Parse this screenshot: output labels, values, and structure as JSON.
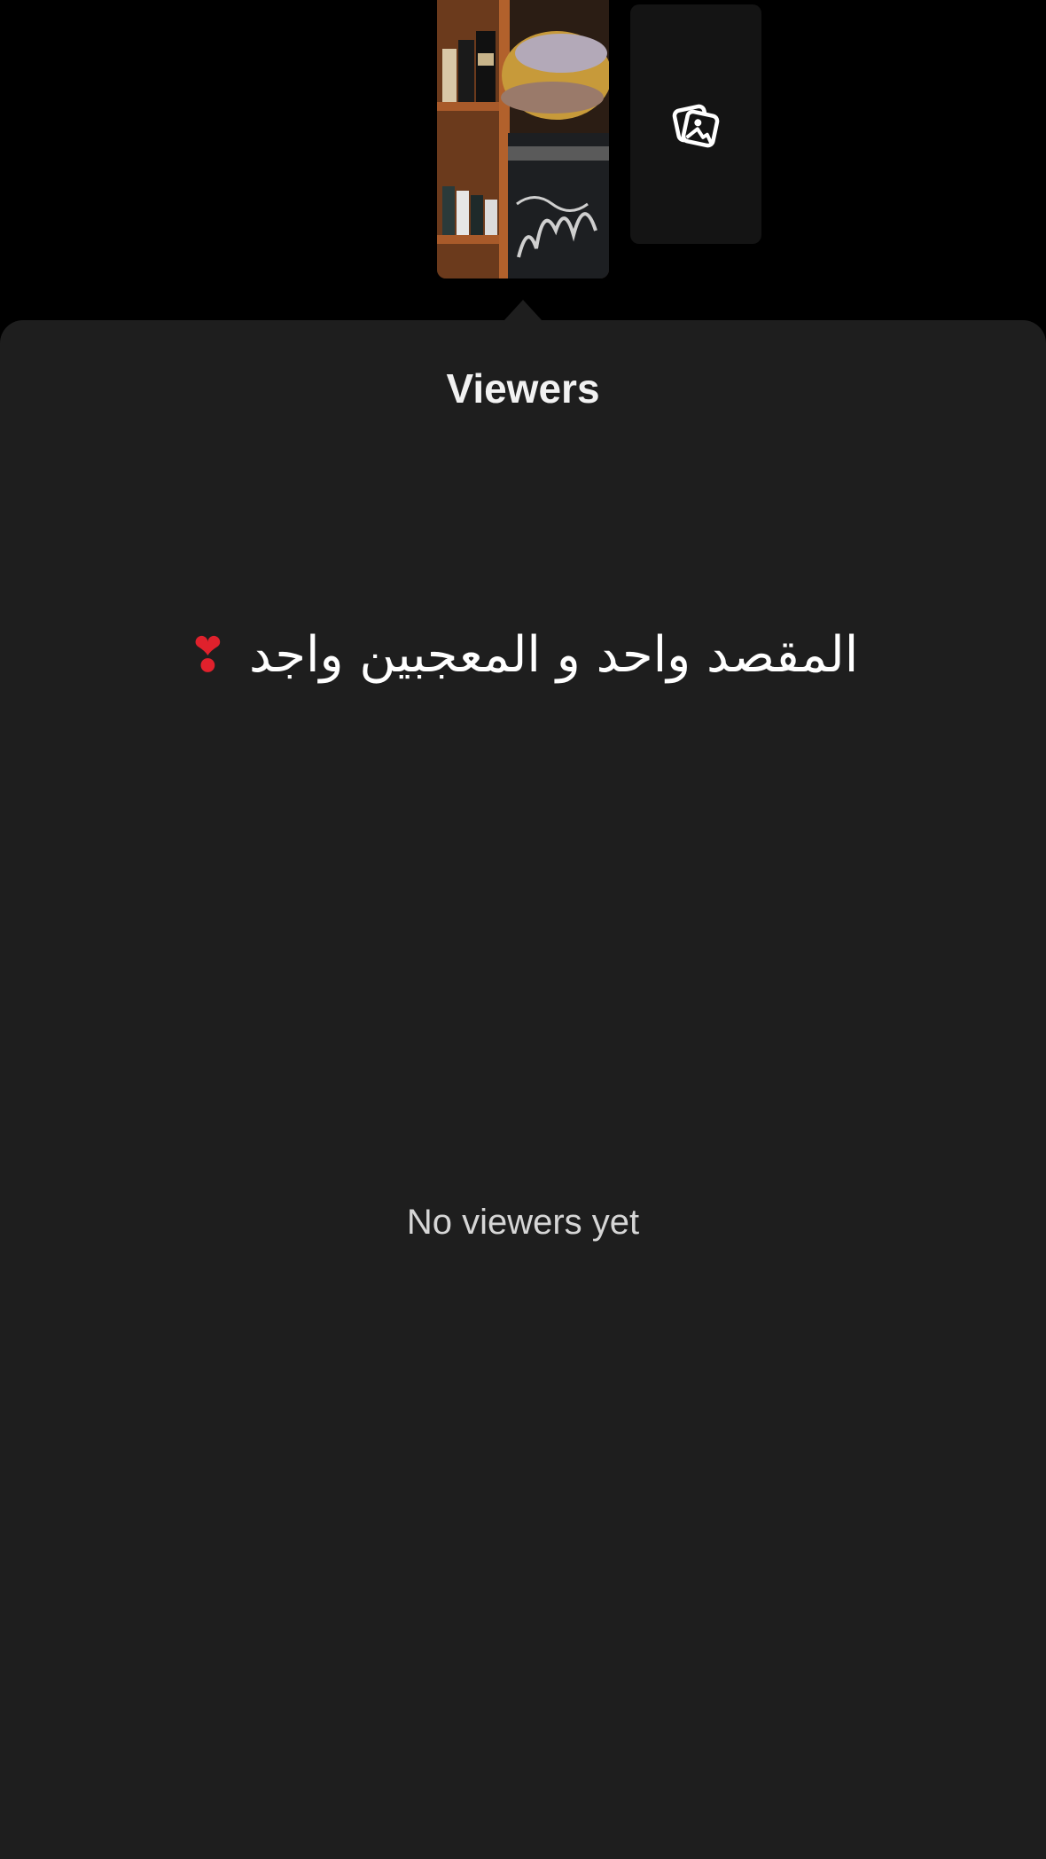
{
  "stories": {
    "thumbnail": {
      "description_icon": "story-thumbnail-image"
    },
    "add_tile": {
      "icon": "image-gallery-icon"
    }
  },
  "viewers_sheet": {
    "title": "Viewers",
    "caption": "المقصد واحد و المعجبين واجد",
    "caption_emoji": "❣",
    "empty_state": "No viewers yet"
  },
  "colors": {
    "background": "#000000",
    "sheet": "#1e1e1e",
    "text_primary": "#f2f2f2",
    "text_secondary": "#d6d6d6",
    "heart": "#e0212c"
  }
}
